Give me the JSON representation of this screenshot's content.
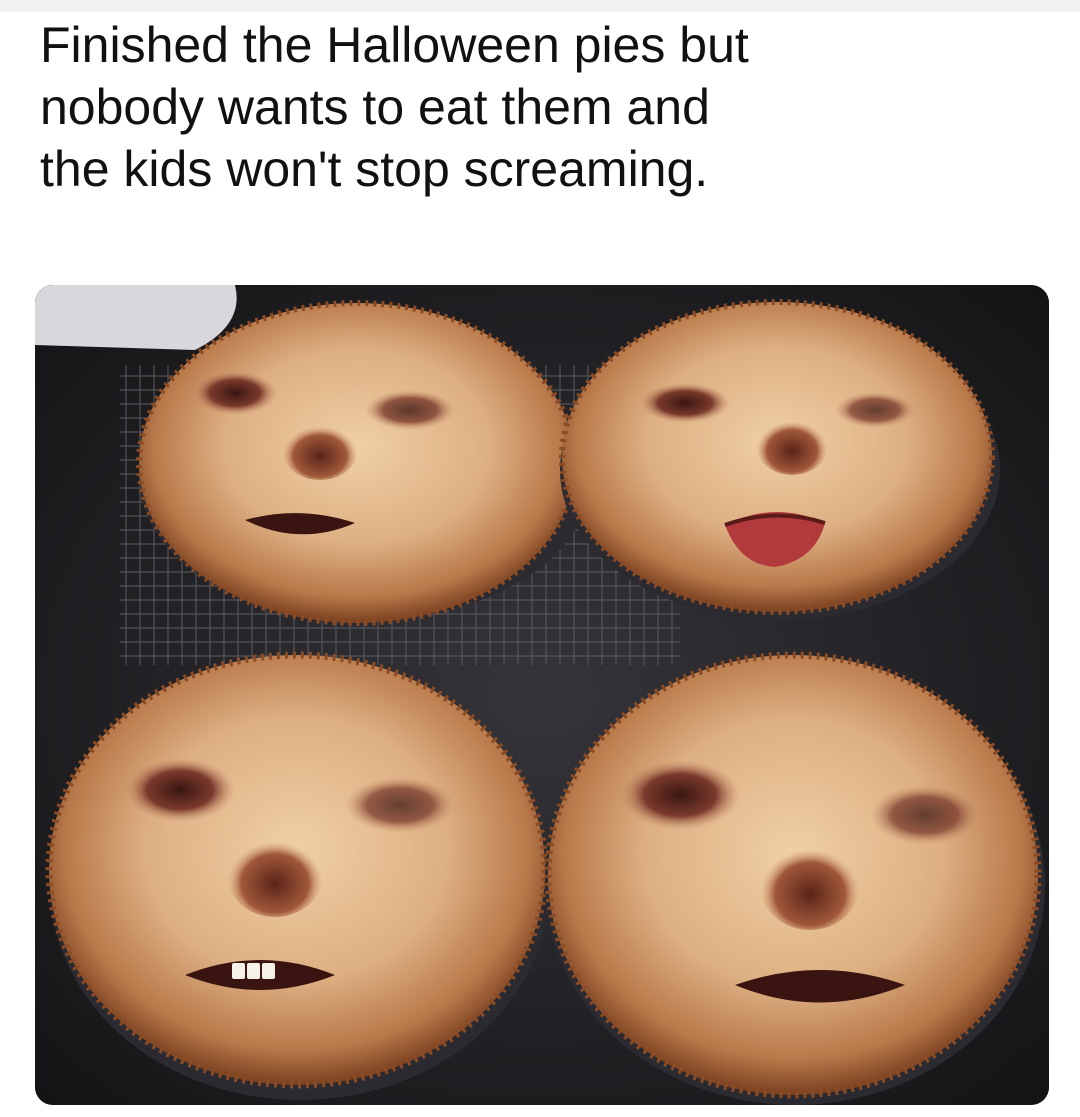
{
  "post": {
    "caption": "Finished the Halloween pies but\nnobody wants to eat them and\nthe kids won't stop screaming."
  },
  "photo": {
    "subject_icon": "face-pie-icon",
    "colors": {
      "counter": "#1f1f22",
      "crust": "#d9a777",
      "crust_edge": "#9a5a2e",
      "lip": "#8a2a24",
      "tongue": "#b33a3c"
    }
  }
}
